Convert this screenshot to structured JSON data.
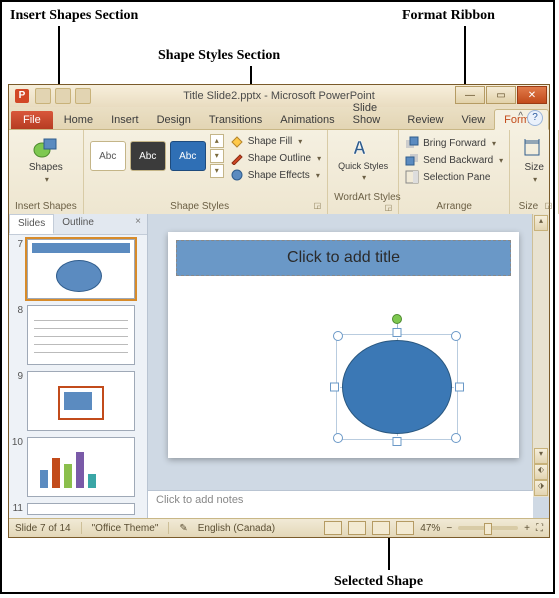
{
  "annotations": {
    "insert_shapes": "Insert Shapes Section",
    "shape_styles": "Shape Styles Section",
    "format_ribbon": "Format Ribbon",
    "selected_shape": "Selected Shape"
  },
  "title": "Title Slide2.pptx - Microsoft PowerPoint",
  "tabs": {
    "file": "File",
    "home": "Home",
    "insert": "Insert",
    "design": "Design",
    "transitions": "Transitions",
    "animations": "Animations",
    "slideshow": "Slide Show",
    "review": "Review",
    "view": "View",
    "format": "Format"
  },
  "ribbon": {
    "shapes_btn": "Shapes",
    "insert_shapes_group": "Insert Shapes",
    "style_label": "Abc",
    "shape_styles_group": "Shape Styles",
    "shape_fill": "Shape Fill",
    "shape_outline": "Shape Outline",
    "shape_effects": "Shape Effects",
    "quick_styles": "Quick Styles",
    "wordart_group": "WordArt Styles",
    "bring_forward": "Bring Forward",
    "send_backward": "Send Backward",
    "selection_pane": "Selection Pane",
    "arrange_group": "Arrange",
    "size_btn": "Size",
    "size_group": "Size"
  },
  "pane": {
    "slides_tab": "Slides",
    "outline_tab": "Outline",
    "nums": {
      "s7": "7",
      "s8": "8",
      "s9": "9",
      "s10": "10",
      "s11": "11"
    }
  },
  "slide": {
    "title_placeholder": "Click to add title",
    "notes_placeholder": "Click to add notes"
  },
  "status": {
    "slide_of": "Slide 7 of 14",
    "theme": "\"Office Theme\"",
    "lang": "English (Canada)",
    "zoom": "47%"
  },
  "colors": {
    "accent": "#3b78b5",
    "file_tab": "#c24b1b"
  }
}
